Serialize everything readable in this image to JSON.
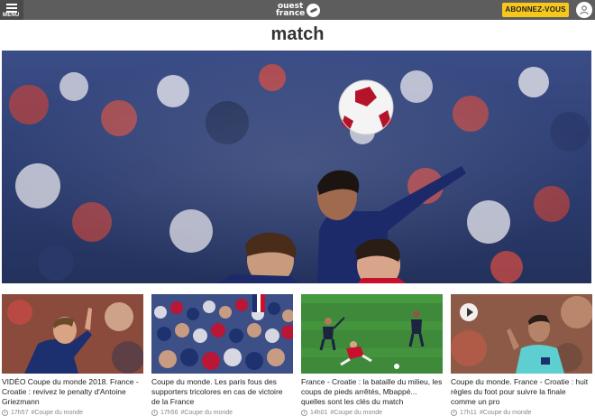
{
  "header": {
    "menu_label": "MENU",
    "logo_line1": "ouest",
    "logo_line2": "france",
    "subscribe_label": "ABONNEZ-VOUS"
  },
  "page": {
    "title": "match"
  },
  "articles": [
    {
      "caption": "VIDÉO Coupe du monde 2018. France - Croatie : revivez le penalty d'Antoine Griezmann",
      "time": "17h57",
      "tag": "#Coupe du monde",
      "has_video": false
    },
    {
      "caption": "Coupe du monde. Les paris fous des supporters tricolores en cas de victoire de la France",
      "time": "17h56",
      "tag": "#Coupe du monde",
      "has_video": false
    },
    {
      "caption": "France - Croatie : la bataille du milieu, les coups de pieds arrêtés, Mbappé... quelles sont les clés du match",
      "time": "14h01",
      "tag": "#Coupe du monde",
      "has_video": false
    },
    {
      "caption": "Coupe du monde. France - Croatie : huit règles du foot pour suivre la finale comme un pro",
      "time": "17h11",
      "tag": "#Coupe du monde",
      "has_video": true
    }
  ],
  "icons": {
    "menu": "menu-icon",
    "account": "user-icon",
    "clock": "clock-icon",
    "play": "play-icon"
  },
  "colors": {
    "topbar": "#5d5d5d",
    "subscribe": "#f7c71b",
    "title": "#333333"
  }
}
